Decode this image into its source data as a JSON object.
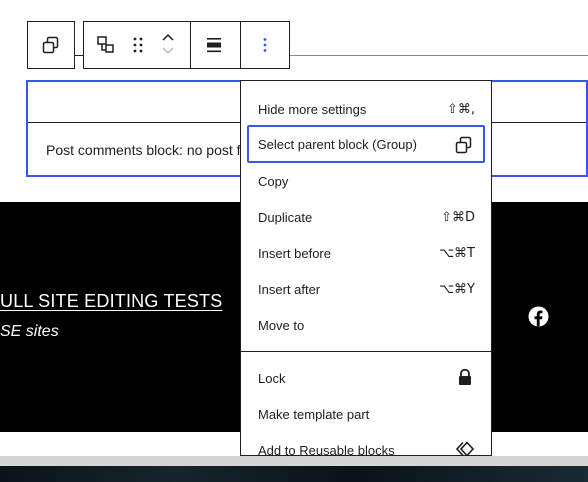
{
  "toolbar": {
    "parent_select_icon": "select-parent-icon",
    "transform_icon": "block-transform-icon",
    "drag_icon": "drag-handle-icon",
    "move_up_icon": "chevron-up-icon",
    "move_down_icon": "chevron-down-icon",
    "align_icon": "align-icon",
    "options_icon": "more-vertical-icon"
  },
  "comments_block": {
    "text": "Post comments block: no post fo"
  },
  "footer": {
    "title": "ULL SITE EDITING TESTS",
    "subtitle": "SE sites",
    "social_icon": "facebook-icon"
  },
  "menu": {
    "group1": [
      {
        "label": "Hide more settings",
        "shortcut": "⇧⌘,"
      },
      {
        "label": "Select parent block (Group)",
        "icon": "select-parent-icon"
      },
      {
        "label": "Copy"
      },
      {
        "label": "Duplicate",
        "shortcut": "⇧⌘D"
      },
      {
        "label": "Insert before",
        "shortcut": "⌥⌘T"
      },
      {
        "label": "Insert after",
        "shortcut": "⌥⌘Y"
      },
      {
        "label": "Move to"
      }
    ],
    "group2": [
      {
        "label": "Lock",
        "icon": "lock-icon"
      },
      {
        "label": "Make template part"
      },
      {
        "label": "Add to Reusable blocks",
        "icon": "reusable-block-icon"
      }
    ]
  },
  "colors": {
    "accent": "#3858e9",
    "text": "#1e1e1e",
    "footer_bg": "#000000"
  }
}
